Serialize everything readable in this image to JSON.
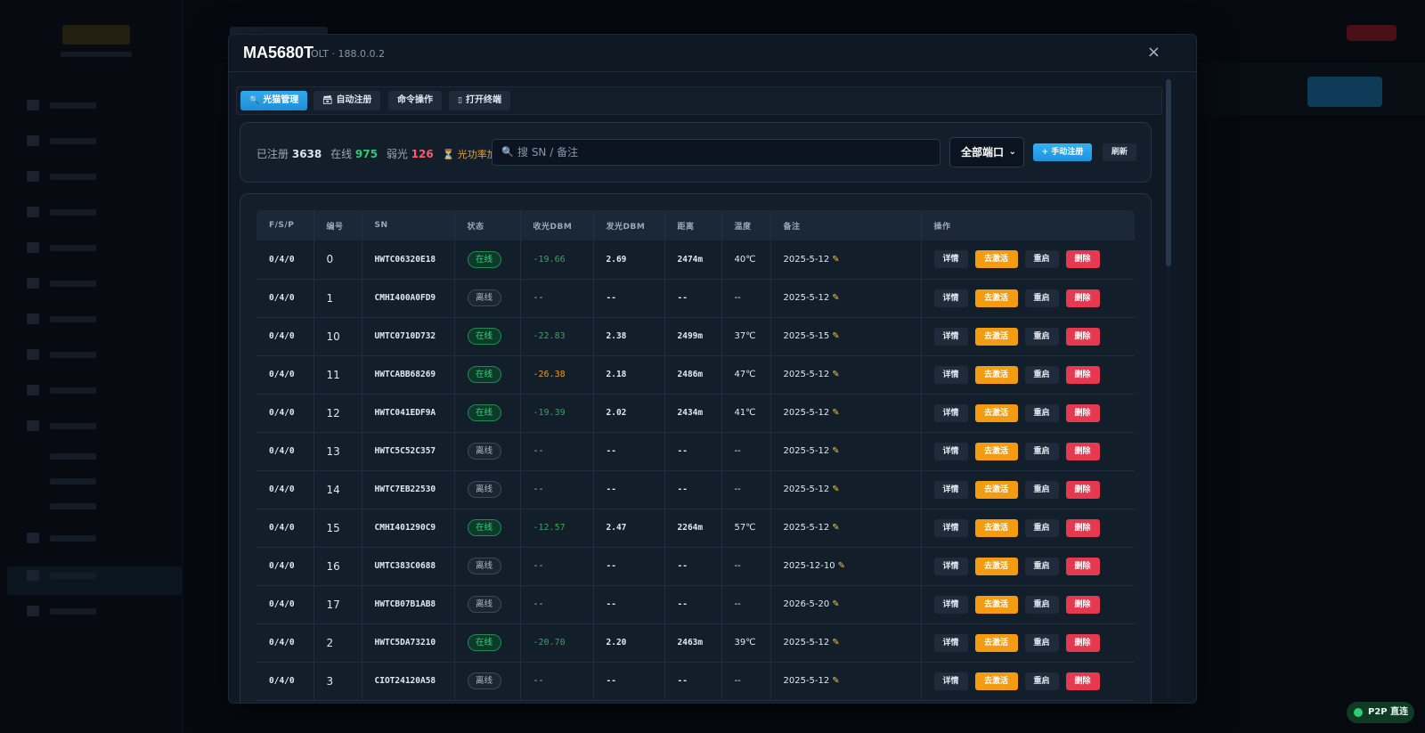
{
  "modal": {
    "title": "MA5680T",
    "subtitle": "OLT · 188.0.0.2",
    "close_glyph": "×"
  },
  "tabs": [
    {
      "icon": "🔍",
      "icon_name": "search-icon",
      "label": "光猫管理",
      "active": true
    },
    {
      "icon": "🗃",
      "icon_name": "register-icon",
      "label": "自动注册",
      "active": false
    },
    {
      "icon": "",
      "icon_name": "",
      "label": "命令操作",
      "active": false
    },
    {
      "icon": "▯",
      "icon_name": "terminal-icon",
      "label": "打开终端",
      "active": false
    }
  ],
  "filter": {
    "registered_label": "已注册",
    "registered_count": "3638",
    "online_label": "在线",
    "online_count": "975",
    "weak_label": "弱光",
    "weak_count": "126",
    "loading_text": "⏳ 光功率加载中...",
    "search_placeholder": "搜 SN / 备注",
    "port_select": "全部端口",
    "register_button": "+ 手动注册",
    "refresh_button": "刷新"
  },
  "table": {
    "headers": [
      "F/S/P",
      "编号",
      "SN",
      "状态",
      "收光DBM",
      "发光DBM",
      "距离",
      "温度",
      "备注",
      "操作"
    ],
    "actions": {
      "detail": "详情",
      "activate": "去激活",
      "reboot": "重启",
      "delete": "删除"
    },
    "rows": [
      {
        "fsp": "0/4/0",
        "id": "0",
        "sn": "HWTC06320E18",
        "status": "在线",
        "online": true,
        "rx": "-19.66",
        "rx_weak": false,
        "tx": "2.69",
        "distance": "2474m",
        "temp": "40℃",
        "note": "2025-5-12"
      },
      {
        "fsp": "0/4/0",
        "id": "1",
        "sn": "CMHI400A0FD9",
        "status": "离线",
        "online": false,
        "rx": "--",
        "rx_weak": false,
        "tx": "--",
        "distance": "--",
        "temp": "--",
        "note": "2025-5-12"
      },
      {
        "fsp": "0/4/0",
        "id": "10",
        "sn": "UMTC0710D732",
        "status": "在线",
        "online": true,
        "rx": "-22.83",
        "rx_weak": false,
        "tx": "2.38",
        "distance": "2499m",
        "temp": "37℃",
        "note": "2025-5-15"
      },
      {
        "fsp": "0/4/0",
        "id": "11",
        "sn": "HWTCABB68269",
        "status": "在线",
        "online": true,
        "rx": "-26.38",
        "rx_weak": true,
        "tx": "2.18",
        "distance": "2486m",
        "temp": "47℃",
        "note": "2025-5-12"
      },
      {
        "fsp": "0/4/0",
        "id": "12",
        "sn": "HWTC041EDF9A",
        "status": "在线",
        "online": true,
        "rx": "-19.39",
        "rx_weak": false,
        "tx": "2.02",
        "distance": "2434m",
        "temp": "41℃",
        "note": "2025-5-12"
      },
      {
        "fsp": "0/4/0",
        "id": "13",
        "sn": "HWTC5C52C357",
        "status": "离线",
        "online": false,
        "rx": "--",
        "rx_weak": false,
        "tx": "--",
        "distance": "--",
        "temp": "--",
        "note": "2025-5-12"
      },
      {
        "fsp": "0/4/0",
        "id": "14",
        "sn": "HWTC7EB22530",
        "status": "离线",
        "online": false,
        "rx": "--",
        "rx_weak": false,
        "tx": "--",
        "distance": "--",
        "temp": "--",
        "note": "2025-5-12"
      },
      {
        "fsp": "0/4/0",
        "id": "15",
        "sn": "CMHI401290C9",
        "status": "在线",
        "online": true,
        "rx": "-12.57",
        "rx_weak": false,
        "tx": "2.47",
        "distance": "2264m",
        "temp": "57℃",
        "note": "2025-5-12"
      },
      {
        "fsp": "0/4/0",
        "id": "16",
        "sn": "UMTC383C0688",
        "status": "离线",
        "online": false,
        "rx": "--",
        "rx_weak": false,
        "tx": "--",
        "distance": "--",
        "temp": "--",
        "note": "2025-12-10"
      },
      {
        "fsp": "0/4/0",
        "id": "17",
        "sn": "HWTCB07B1AB8",
        "status": "离线",
        "online": false,
        "rx": "--",
        "rx_weak": false,
        "tx": "--",
        "distance": "--",
        "temp": "--",
        "note": "2026-5-20"
      },
      {
        "fsp": "0/4/0",
        "id": "2",
        "sn": "HWTC5DA73210",
        "status": "在线",
        "online": true,
        "rx": "-20.70",
        "rx_weak": false,
        "tx": "2.20",
        "distance": "2463m",
        "temp": "39℃",
        "note": "2025-5-12"
      },
      {
        "fsp": "0/4/0",
        "id": "3",
        "sn": "CIOT24120A58",
        "status": "离线",
        "online": false,
        "rx": "--",
        "rx_weak": false,
        "tx": "--",
        "distance": "--",
        "temp": "--",
        "note": "2025-5-12"
      }
    ]
  },
  "p2p_badge": "P2P 直连",
  "colors": {
    "accent": "#1f8ed8",
    "online": "#2ecc71",
    "weak": "#ff5a6a",
    "activate": "#f39c12",
    "delete": "#e53950"
  }
}
